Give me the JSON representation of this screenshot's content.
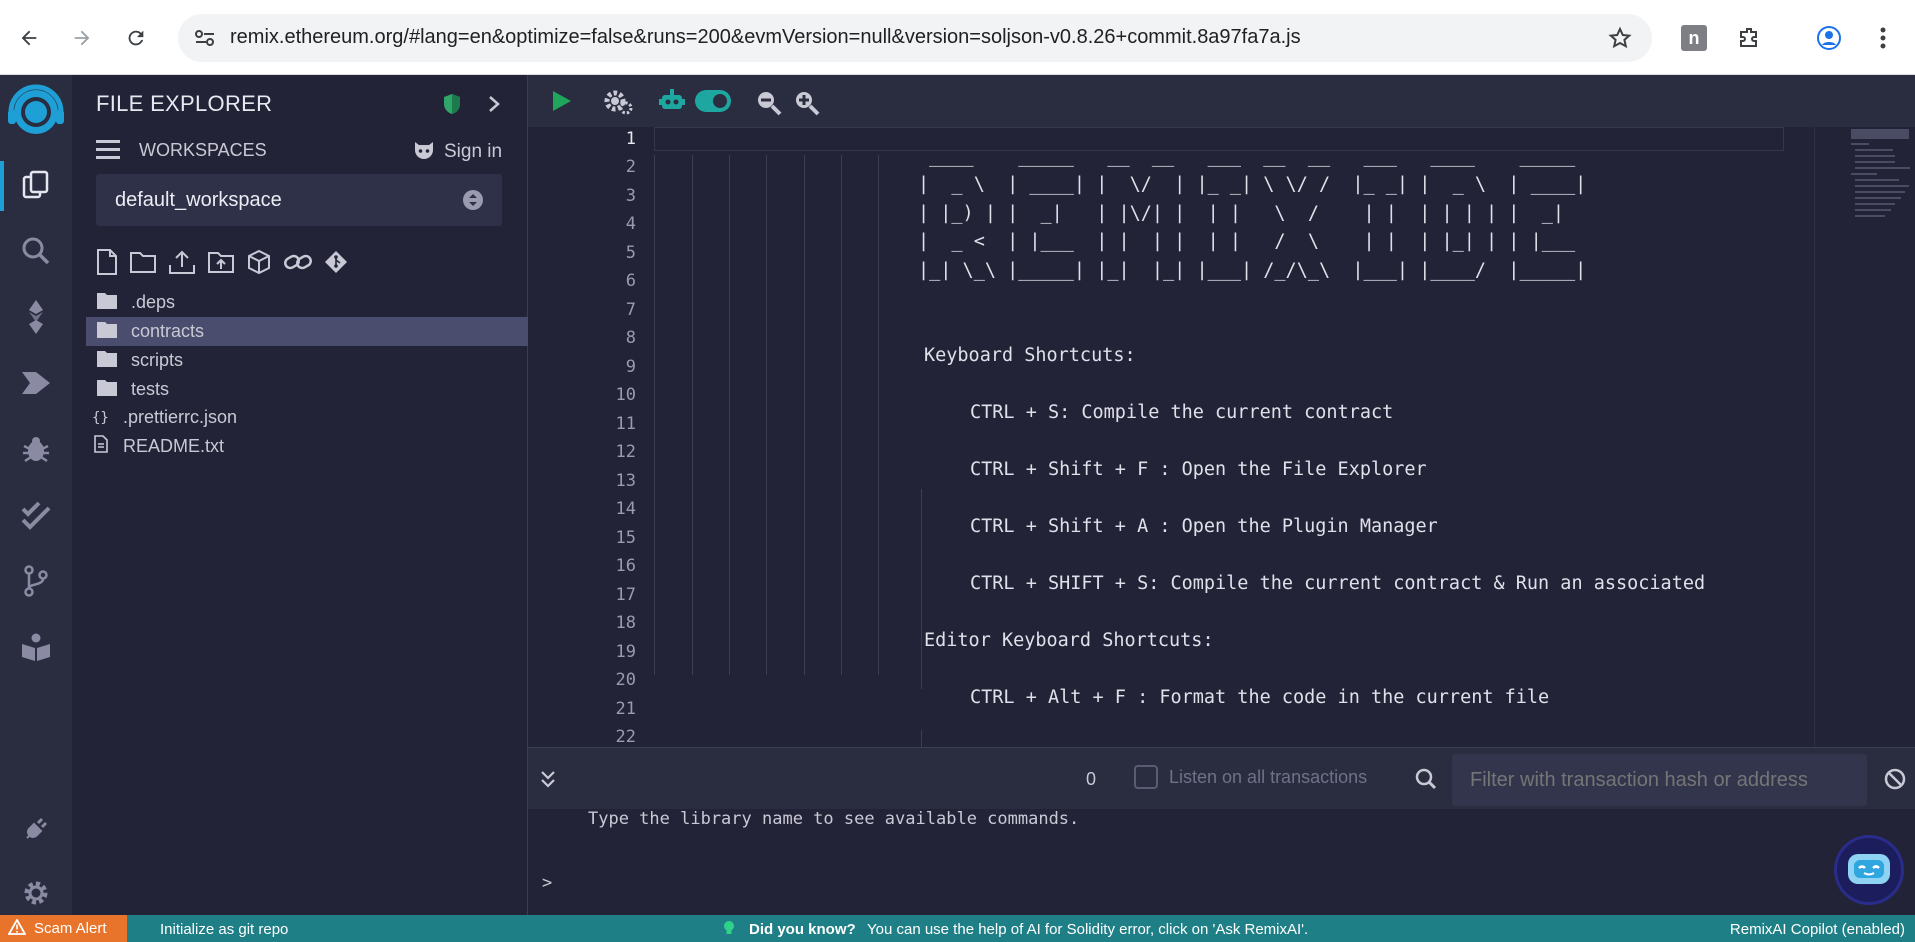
{
  "browser": {
    "url": "remix.ethereum.org/#lang=en&optimize=false&runs=200&evmVersion=null&version=soljson-v0.8.26+commit.8a97fa7a.js"
  },
  "sidepanel": {
    "title": "FILE EXPLORER",
    "workspaces_label": "WORKSPACES",
    "sign_in_label": "Sign in",
    "workspace_selected": "default_workspace",
    "files": [
      {
        "name": ".deps",
        "type": "folder",
        "selected": false
      },
      {
        "name": "contracts",
        "type": "folder",
        "selected": true
      },
      {
        "name": "scripts",
        "type": "folder",
        "selected": false
      },
      {
        "name": "tests",
        "type": "folder",
        "selected": false
      },
      {
        "name": ".prettierrc.json",
        "type": "json",
        "selected": false
      },
      {
        "name": "README.txt",
        "type": "file",
        "selected": false
      }
    ]
  },
  "editor": {
    "line_numbers": [
      "1",
      "2",
      "3",
      "4",
      "5",
      "6",
      "7",
      "8",
      "9",
      "10",
      "11",
      "12",
      "13",
      "14",
      "15",
      "16",
      "17",
      "18",
      "19",
      "20",
      "21",
      "22"
    ],
    "banner": [
      " ____    _____   __  __   ___  __  __   ___   ____    _____ ",
      "|  _ \\  | ____| |  \\/  | |_ _| \\ \\/ /  |_ _| |  _ \\  | ____|",
      "| |_) | |  _|   | |\\/| |  | |   \\  /    | |  | | | | |  _|  ",
      "|  _ <  | |___  | |  | |  | |   /  \\    | |  | |_| | | |___ ",
      "|_| \\_\\ |_____| |_|  |_| |___| /_/\\_\\  |___| |____/  |_____|"
    ],
    "shortcuts_title": "Keyboard Shortcuts:",
    "shortcut_1": "CTRL + S: Compile the current contract",
    "shortcut_2": "CTRL + Shift + F : Open the File Explorer",
    "shortcut_3": "CTRL + Shift + A : Open the Plugin Manager",
    "shortcut_4": "CTRL + SHIFT + S: Compile the current contract & Run an associated",
    "editor_shortcuts_title": "Editor Keyboard Shortcuts:",
    "editor_shortcut_1": "CTRL + Alt + F : Format the code in the current file"
  },
  "terminal": {
    "tx_count": "0",
    "listen_label": "Listen on all transactions",
    "filter_placeholder": "Filter with transaction hash or address",
    "message": "Type the library name to see available commands.",
    "prompt": ">"
  },
  "statusbar": {
    "scam_alert": "Scam Alert",
    "git_init": "Initialize as git repo",
    "did_you_know": "Did you know?",
    "tip": "You can use the help of AI for Solidity error, click on 'Ask RemixAI'.",
    "copilot": "RemixAI Copilot (enabled)"
  },
  "colors": {
    "accent_teal": "#1ea7a0",
    "play_green": "#1fa65a",
    "status_teal": "#1f7f86",
    "scam_orange": "#e7742a",
    "selected_row": "#4b4d6e"
  }
}
